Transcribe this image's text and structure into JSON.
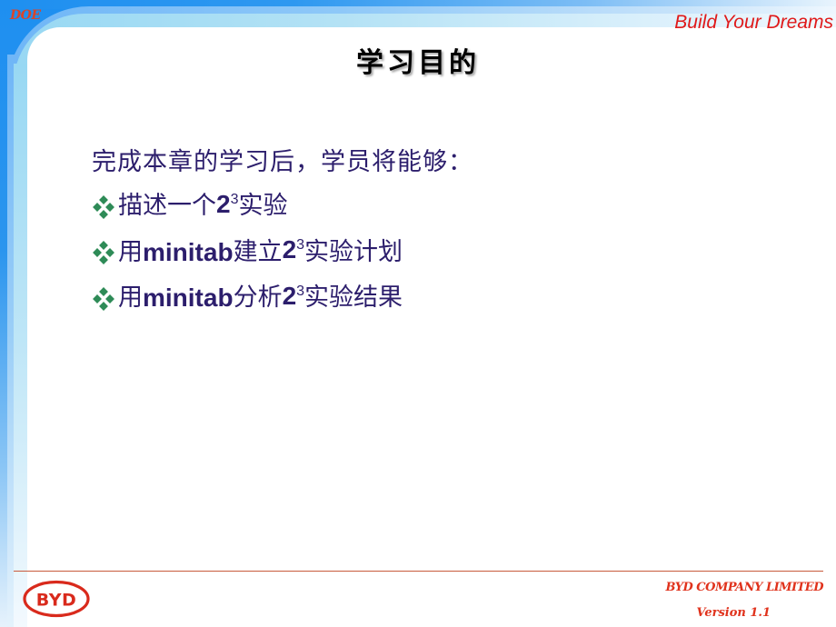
{
  "header": {
    "section_label": "DOE",
    "tagline": "Build Your Dreams"
  },
  "slide": {
    "title": "学习目的",
    "intro": "完成本章的学习后，学员将能够：",
    "bullets": [
      {
        "icon": "diamond-bullet-icon",
        "parts": [
          {
            "text": "描述一个",
            "style": "cjk"
          },
          {
            "text": "2",
            "style": "latin",
            "sup": "3"
          },
          {
            "text": "实验",
            "style": "cjk"
          }
        ]
      },
      {
        "icon": "diamond-bullet-icon",
        "parts": [
          {
            "text": "用",
            "style": "cjk"
          },
          {
            "text": "minitab",
            "style": "latin"
          },
          {
            "text": "建立",
            "style": "cjk"
          },
          {
            "text": "2",
            "style": "latin",
            "sup": "3"
          },
          {
            "text": "实验计划",
            "style": "cjk"
          }
        ]
      },
      {
        "icon": "diamond-bullet-icon",
        "parts": [
          {
            "text": "用",
            "style": "cjk"
          },
          {
            "text": "minitab",
            "style": "latin"
          },
          {
            "text": "分析",
            "style": "cjk"
          },
          {
            "text": "2",
            "style": "latin",
            "sup": "3"
          },
          {
            "text": "实验结果",
            "style": "cjk"
          }
        ]
      }
    ]
  },
  "footer": {
    "logo_text": "BYD",
    "company": "BYD COMPANY LIMITED",
    "version": "Version 1.1"
  },
  "colors": {
    "body_text": "#2c1e6c",
    "bullet": "#2e8b57",
    "accent_red": "#e01a1a",
    "frame_blue": "#1e8ff0"
  }
}
